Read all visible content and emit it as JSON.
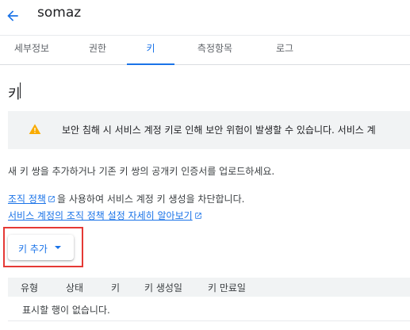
{
  "header": {
    "title": "somaz",
    "back_icon": "arrow-back-icon"
  },
  "tabs": [
    {
      "label": "세부정보"
    },
    {
      "label": "권한"
    },
    {
      "label": "키"
    },
    {
      "label": "측정항목"
    },
    {
      "label": "로그"
    }
  ],
  "active_tab": "키",
  "page": {
    "heading": "키"
  },
  "warning": {
    "icon": "warning-icon",
    "text": "보안 침해 시 서비스 계정 키로 인해 보안 위험이 발생할 수 있습니다. 서비스 계"
  },
  "description": "새 키 쌍을 추가하거나 기존 키 쌍의 공개키 인증서를 업로드하세요.",
  "policy": {
    "link_text": "조직 정책",
    "suffix": "을 사용하여 서비스 계정 키 생성을 차단합니다.",
    "learn_more": "서비스 계정의 조직 정책 설정 자세히 알아보기"
  },
  "add_key": {
    "label": "키 추가"
  },
  "table": {
    "columns": [
      "유형",
      "상태",
      "키",
      "키 생성일",
      "키 만료일"
    ],
    "empty_text": "표시할 행이 없습니다."
  },
  "colors": {
    "accent": "#1a73e8",
    "warning": "#f9ab00",
    "highlight": "#e53935"
  }
}
